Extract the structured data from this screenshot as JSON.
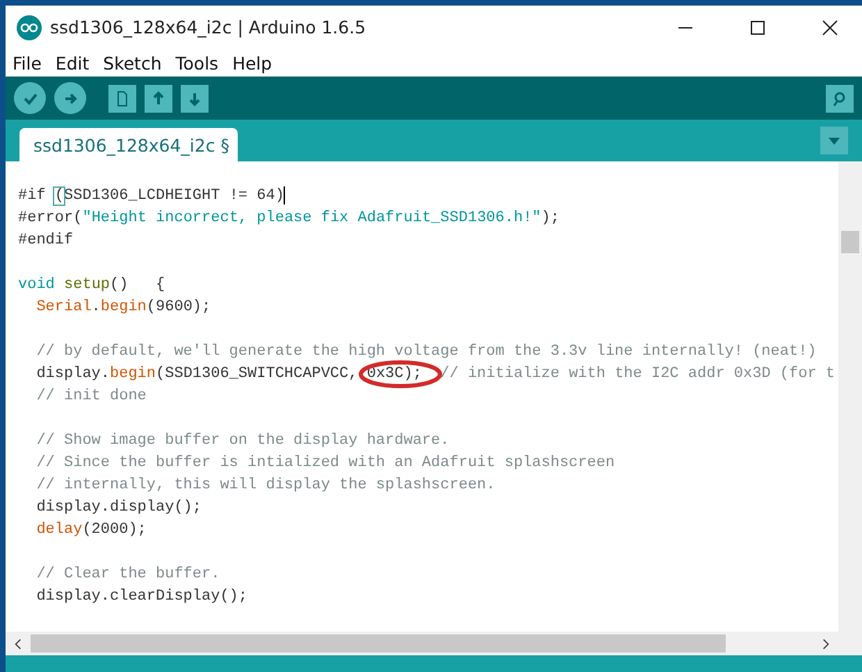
{
  "window": {
    "title": "ssd1306_128x64_i2c | Arduino 1.6.5"
  },
  "menu": [
    "File",
    "Edit",
    "Sketch",
    "Tools",
    "Help"
  ],
  "tabs": [
    {
      "label": "ssd1306_128x64_i2c §",
      "selected": true
    }
  ],
  "code_blocks": [
    [
      {
        "indent": false,
        "cursor": true,
        "segments": [
          {
            "kind": "plain",
            "text": "#if "
          },
          {
            "kind": "bracket",
            "text": "("
          },
          {
            "kind": "plain",
            "text": "SSD1306_LCDHEIGHT != 64)"
          }
        ]
      },
      {
        "indent": false,
        "segments": [
          {
            "kind": "plain",
            "text": "#error("
          },
          {
            "kind": "string",
            "text": "\"Height incorrect, please fix Adafruit_SSD1306.h!\""
          },
          {
            "kind": "plain",
            "text": ");"
          }
        ]
      },
      {
        "indent": false,
        "segments": [
          {
            "kind": "plain",
            "text": "#endif"
          }
        ]
      }
    ],
    [
      {
        "indent": false,
        "segments": [
          {
            "kind": "keyword",
            "text": "void "
          },
          {
            "kind": "name",
            "text": "setup"
          },
          {
            "kind": "plain",
            "text": "()   {"
          }
        ]
      },
      {
        "indent": true,
        "segments": [
          {
            "kind": "func",
            "text": "Serial"
          },
          {
            "kind": "plain",
            "text": "."
          },
          {
            "kind": "func",
            "text": "begin"
          },
          {
            "kind": "plain",
            "text": "(9600);"
          }
        ]
      }
    ],
    [
      {
        "indent": true,
        "segments": [
          {
            "kind": "comment",
            "text": "// by default, we'll generate the high voltage from the 3.3v line internally! (neat!)"
          }
        ]
      },
      {
        "indent": true,
        "circled": true,
        "segments": [
          {
            "kind": "plain",
            "text": "display."
          },
          {
            "kind": "func",
            "text": "begin"
          },
          {
            "kind": "plain",
            "text": "(SSD1306_SWITCHCAPVCC, 0x3C);  "
          },
          {
            "kind": "comment",
            "text": "// initialize with the I2C addr 0x3D (for t"
          }
        ]
      },
      {
        "indent": true,
        "segments": [
          {
            "kind": "comment",
            "text": "// init done"
          }
        ]
      }
    ],
    [
      {
        "indent": true,
        "segments": [
          {
            "kind": "comment",
            "text": "// Show image buffer on the display hardware."
          }
        ]
      },
      {
        "indent": true,
        "segments": [
          {
            "kind": "comment",
            "text": "// Since the buffer is intialized with an Adafruit splashscreen"
          }
        ]
      },
      {
        "indent": true,
        "segments": [
          {
            "kind": "comment",
            "text": "// internally, this will display the splashscreen."
          }
        ]
      },
      {
        "indent": true,
        "segments": [
          {
            "kind": "plain",
            "text": "display.display();"
          }
        ]
      },
      {
        "indent": true,
        "segments": [
          {
            "kind": "func",
            "text": "delay"
          },
          {
            "kind": "plain",
            "text": "(2000);"
          }
        ]
      }
    ],
    [
      {
        "indent": true,
        "segments": [
          {
            "kind": "comment",
            "text": "// Clear the buffer."
          }
        ]
      },
      {
        "indent": true,
        "segments": [
          {
            "kind": "plain",
            "text": "display.clearDisplay();"
          }
        ]
      }
    ]
  ]
}
